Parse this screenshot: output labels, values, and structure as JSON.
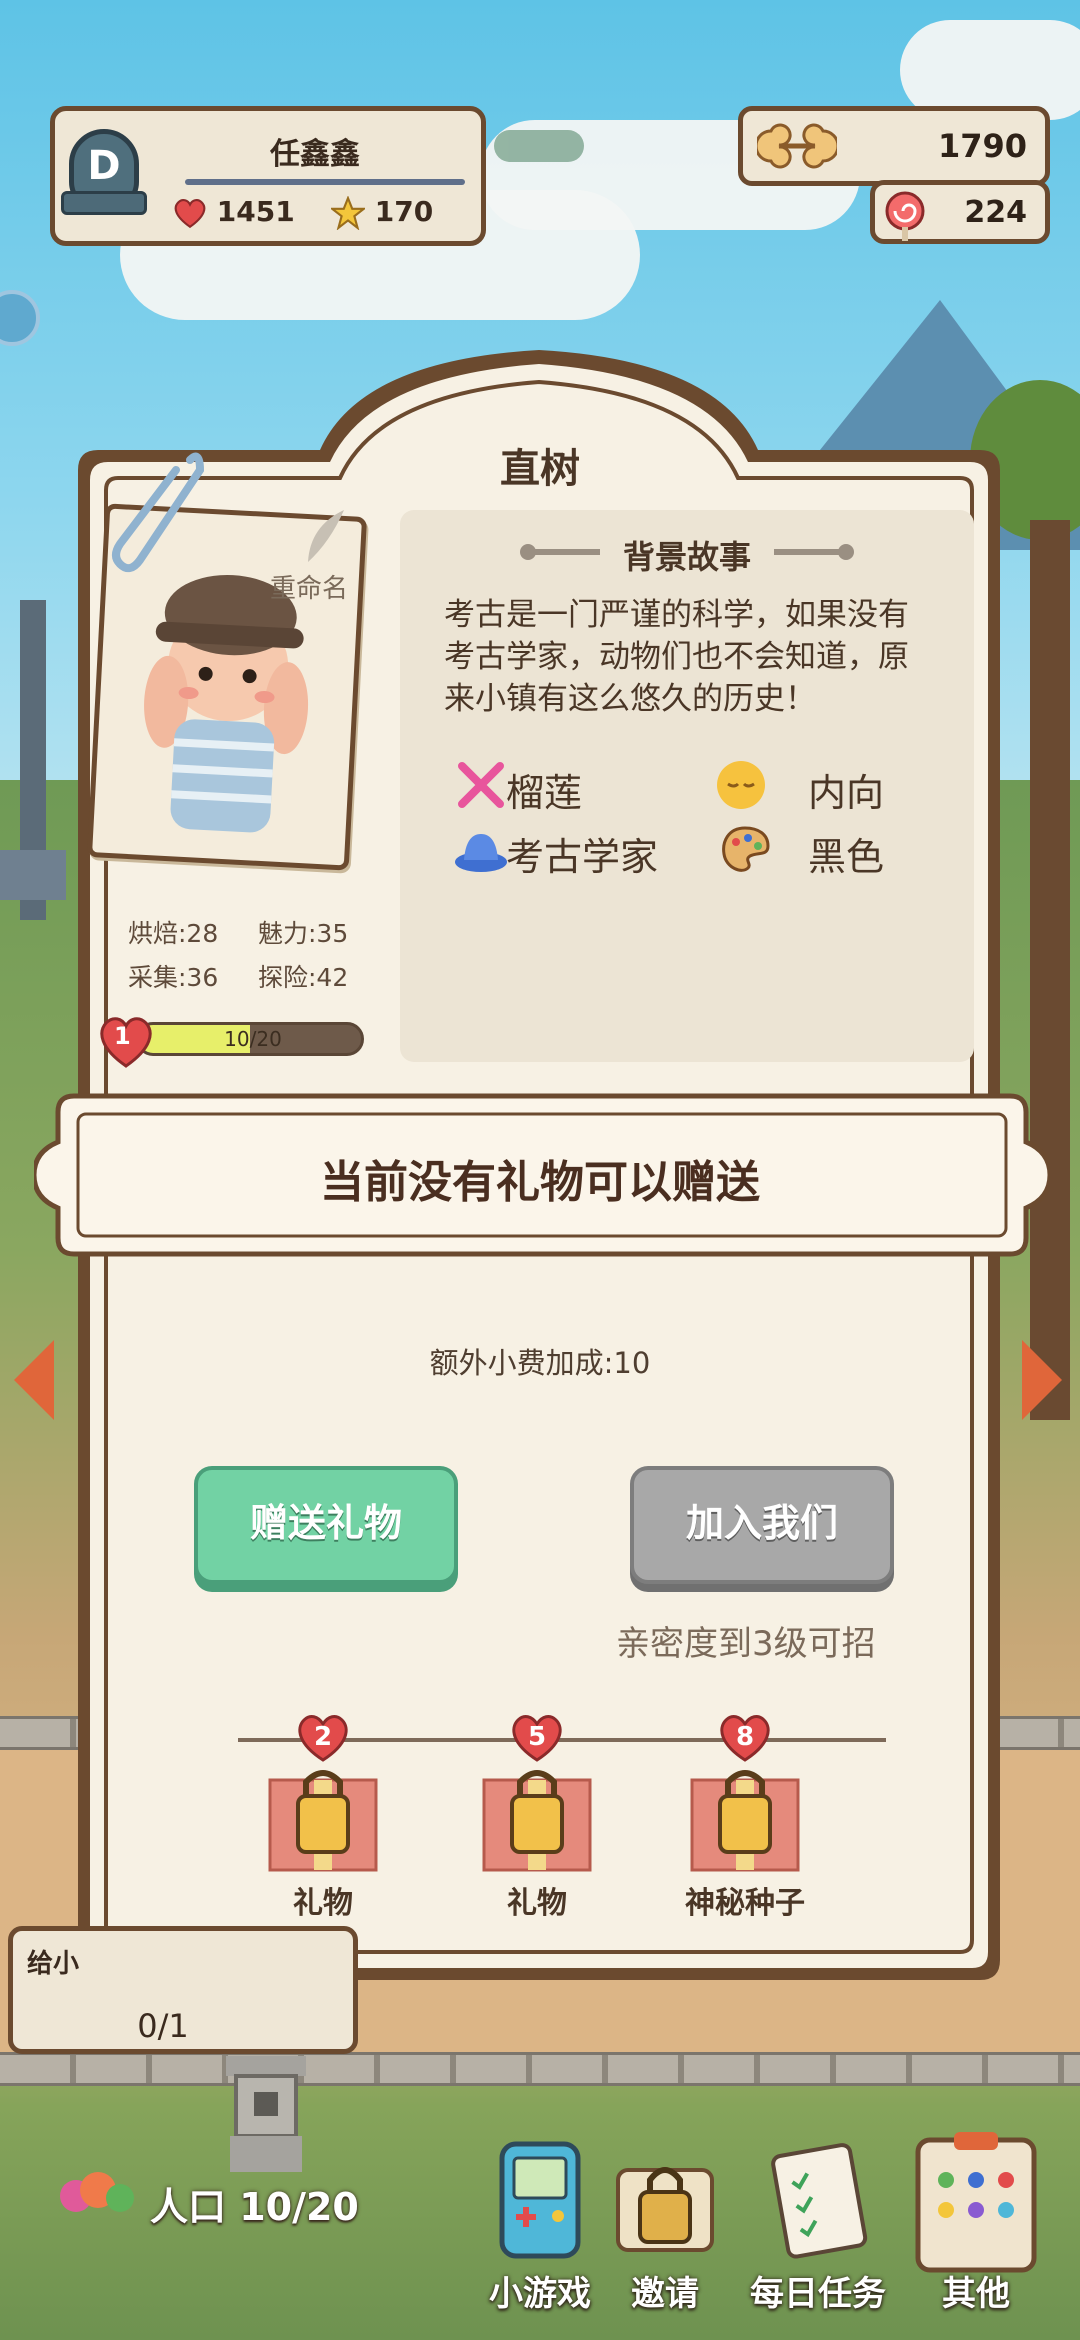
{
  "player": {
    "rank_letter": "D",
    "name": "任鑫鑫",
    "hearts": "1451",
    "stars": "170"
  },
  "resources": {
    "bones": "1790",
    "candy": "224"
  },
  "character": {
    "name": "直树",
    "rename_label": "重命名",
    "stats": {
      "baking": "烘焙:28",
      "charm": "魅力:35",
      "gathering": "采集:36",
      "adventure": "探险:42"
    },
    "bond_level": "1",
    "bond_progress_text": "10/20",
    "bond_progress_fraction": 0.5
  },
  "story": {
    "heading": "背景故事",
    "text": "考古是一门严谨的科学，如果没有考古学家，动物们也不会知道，原来小镇有这么悠久的历史！",
    "traits": {
      "food": "榴莲",
      "personality": "内向",
      "job": "考古学家",
      "color": "黑色"
    }
  },
  "gift": {
    "banner_text": "当前没有礼物可以赠送",
    "extra_tip": "额外小费加成:10",
    "send_button": "赠送礼物",
    "join_button": "加入我们",
    "join_hint": "亲密度到3级可招"
  },
  "rewards": [
    {
      "level": "2",
      "label": "礼物"
    },
    {
      "level": "5",
      "label": "礼物"
    },
    {
      "level": "8",
      "label": "神秘种子"
    }
  ],
  "hud": {
    "task_title": "给小",
    "task_count": "0/1",
    "population": "人口 10/20",
    "nav": {
      "minigame": "小游戏",
      "invite": "邀请",
      "daily": "每日任务",
      "other": "其他"
    }
  },
  "colors": {
    "accent_green": "#72d2a4",
    "disabled_gray": "#a8a8a8",
    "frame_brown": "#6b4a2f",
    "heart_red": "#e24b4b"
  }
}
